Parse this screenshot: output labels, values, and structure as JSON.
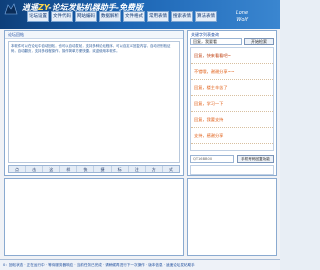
{
  "banner": {
    "brand_prefix": "逍遥",
    "brand_zy": "ZY",
    "brand_suffix": "-论坛发贴机器助手-免费版",
    "wolf_line1": "Lone",
    "wolf_line2": "Wolf"
  },
  "nav": [
    {
      "label": "论坛设置"
    },
    {
      "label": "文件代码"
    },
    {
      "label": "网站编码"
    },
    {
      "label": "数据解析"
    },
    {
      "label": "文件格式"
    },
    {
      "label": "常用表情"
    },
    {
      "label": "搜索表情"
    },
    {
      "label": "算法表情"
    }
  ],
  "left_panel": {
    "title": "论坛回帖",
    "body": "本软件可以在论坛中自动回帖，也可以自动发帖，支持多种论坛程序，可以自定义回复内容，自动识别验证码，自动翻页，支持多线程操作，操作简单方便快捷，欢迎使用本软件。"
  },
  "quick_bar": [
    "点",
    "击",
    "这",
    "样",
    "快",
    "捷",
    "标",
    "注",
    "方",
    "式"
  ],
  "right_panel": {
    "title": "关键字列表查询",
    "search_value": "回复，我要看",
    "search_button": "开始检索",
    "results": [
      {
        "text": "回复，快来看看吧~"
      },
      {
        "text": "不错哦，谢谢分享~~"
      },
      {
        "text": "回复，楼主辛苦了"
      },
      {
        "text": "回复，学习一下"
      },
      {
        "text": "回复，我要支持"
      },
      {
        "text": "支持，感谢分享"
      }
    ],
    "id_placeholder": "QT16BB00",
    "id_button": "手机号码回复功能"
  },
  "statusbar": {
    "text": "0：回帖状态 · 正在运行中 · 等待服务器响应 · 当前任务已完成 · 请稍候再进行下一次操作 · 版本信息 · 逍遥论坛发帖助手"
  },
  "colors": {
    "banner_start": "#0e3f7a",
    "banner_end": "#3a86d0",
    "accent_text": "#e05a10",
    "link_blue": "#1a4aa0"
  }
}
